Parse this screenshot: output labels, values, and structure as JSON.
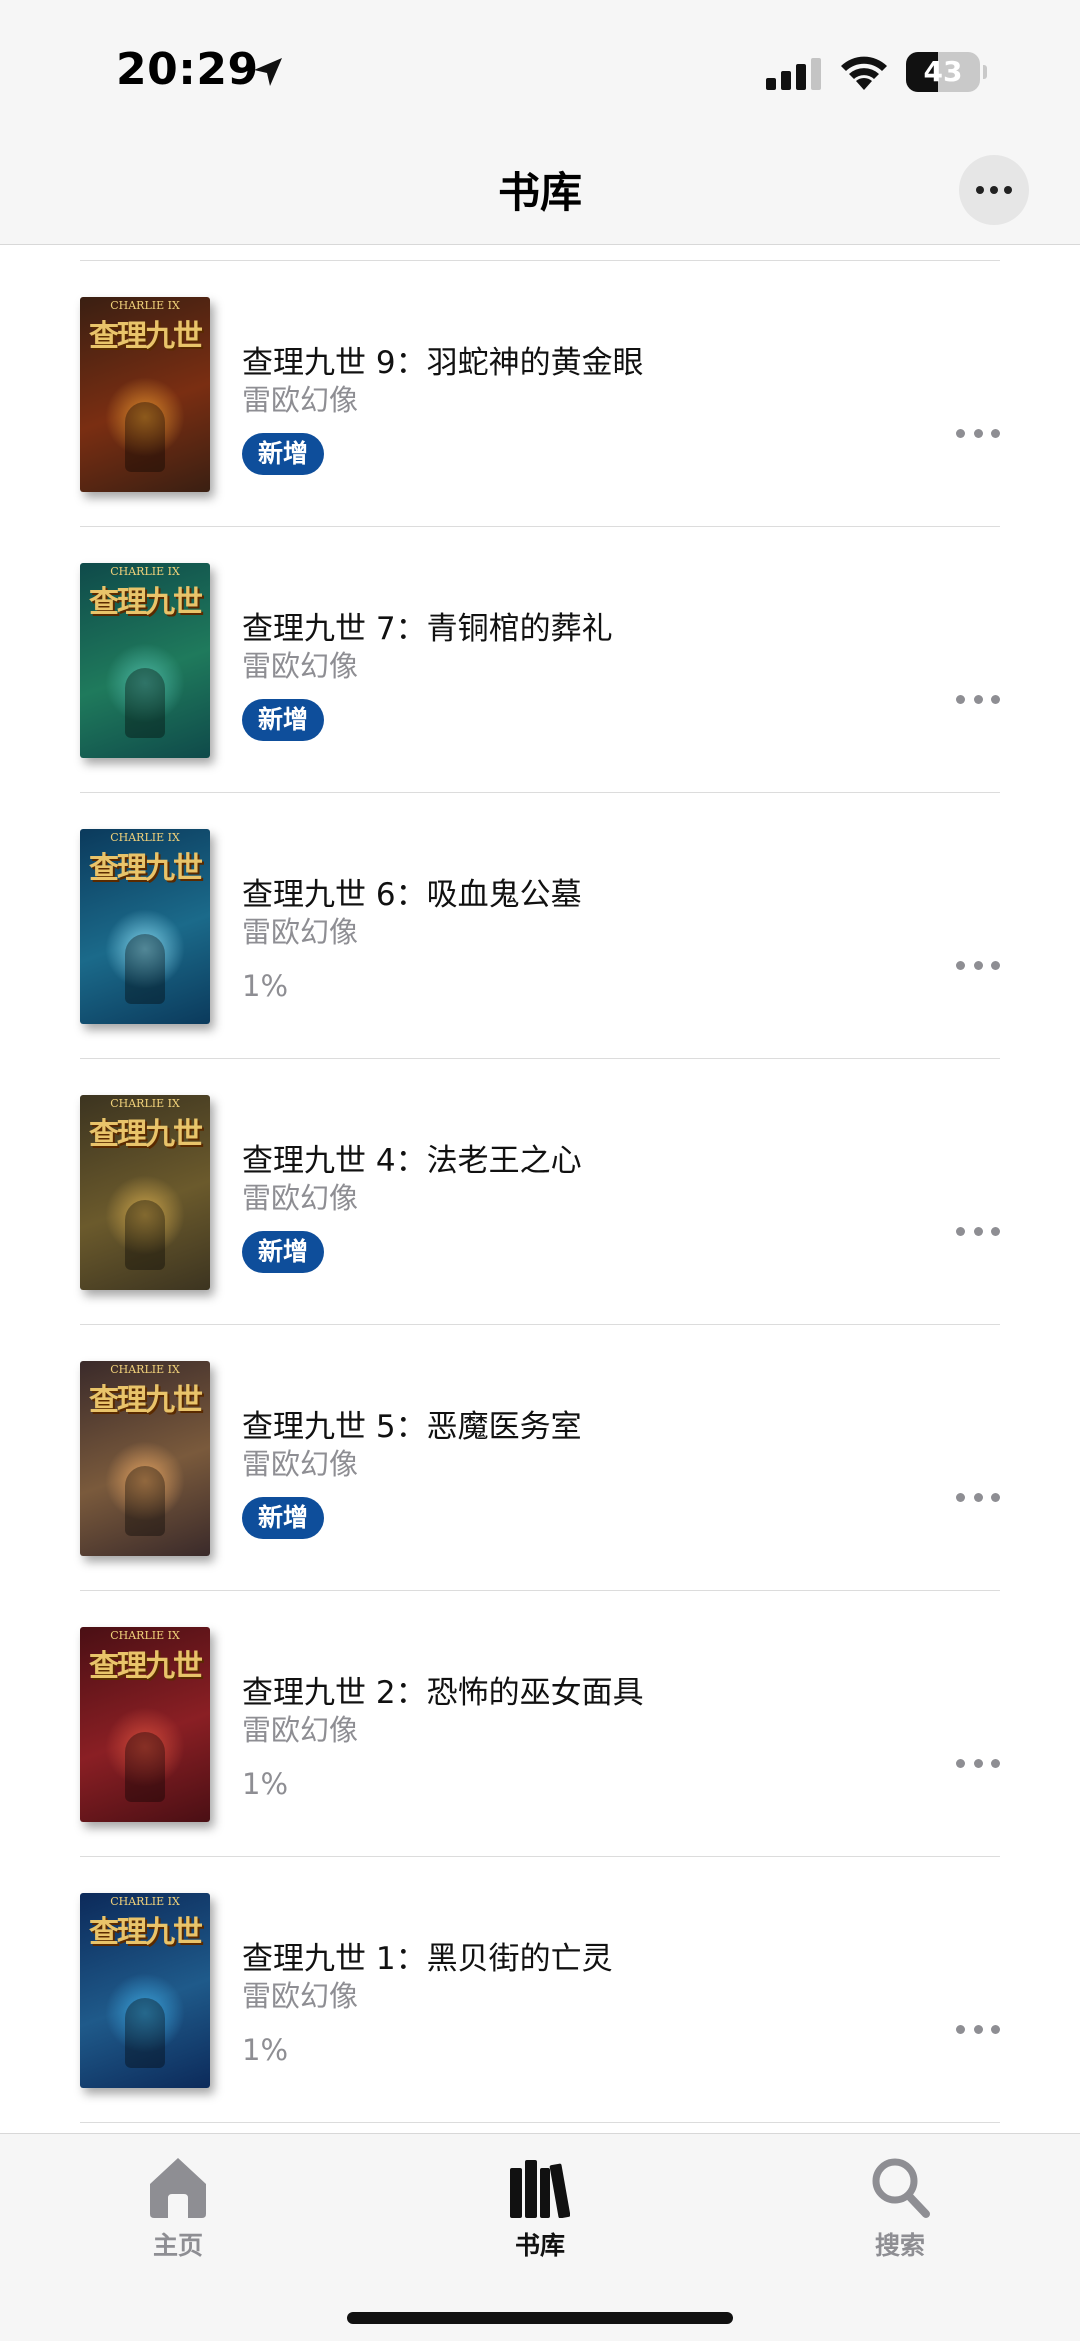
{
  "status_bar": {
    "time": "20:29",
    "battery_level": "43",
    "battery_fraction": 0.43
  },
  "nav": {
    "title": "书库",
    "more_icon": "ellipsis-icon"
  },
  "books": [
    {
      "title": "查理九世 9：羽蛇神的黄金眼",
      "author": "雷欧幻像",
      "badge": "新增",
      "progress": null,
      "cover_bg": [
        "#3a1f12",
        "#7a2e12"
      ],
      "cover_glow": "#d98a2b"
    },
    {
      "title": "查理九世 7：青铜棺的葬礼",
      "author": "雷欧幻像",
      "badge": "新增",
      "progress": null,
      "cover_bg": [
        "#0f4a4a",
        "#1f7a5c"
      ],
      "cover_glow": "#4ab3a0"
    },
    {
      "title": "查理九世 6：吸血鬼公墓",
      "author": "雷欧幻像",
      "badge": null,
      "progress": "1%",
      "cover_bg": [
        "#0b3a5c",
        "#1b6a8a"
      ],
      "cover_glow": "#7fd0e8"
    },
    {
      "title": "查理九世 4：法老王之心",
      "author": "雷欧幻像",
      "badge": "新增",
      "progress": null,
      "cover_bg": [
        "#3c3420",
        "#6b5a2c"
      ],
      "cover_glow": "#c9a24a"
    },
    {
      "title": "查理九世 5：恶魔医务室",
      "author": "雷欧幻像",
      "badge": "新增",
      "progress": null,
      "cover_bg": [
        "#3a2a2a",
        "#7a5a3c"
      ],
      "cover_glow": "#e0a060"
    },
    {
      "title": "查理九世 2：恐怖的巫女面具",
      "author": "雷欧幻像",
      "badge": null,
      "progress": "1%",
      "cover_bg": [
        "#4a0f14",
        "#8a1f24"
      ],
      "cover_glow": "#d04a3a"
    },
    {
      "title": "查理九世 1：黑贝街的亡灵",
      "author": "雷欧幻像",
      "badge": null,
      "progress": "1%",
      "cover_bg": [
        "#0c2a5a",
        "#1f5a8a"
      ],
      "cover_glow": "#3aa0d8"
    }
  ],
  "cover_text": {
    "logo": "查理九世",
    "english": "CHARLIE IX"
  },
  "tabs": [
    {
      "label": "主页",
      "icon": "home-icon",
      "active": false
    },
    {
      "label": "书库",
      "icon": "library-icon",
      "active": true
    },
    {
      "label": "搜索",
      "icon": "search-icon",
      "active": false
    }
  ],
  "colors": {
    "badge_bg": "#0e4e9b",
    "secondary_text": "#8e8e93",
    "bar_bg": "#f6f6f6"
  }
}
